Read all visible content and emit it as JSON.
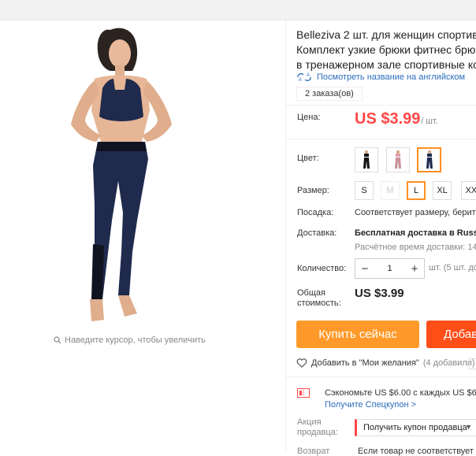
{
  "product": {
    "title_lines": [
      "Belleziva 2 шт. для женщин спортивный",
      "Комплект узкие брюки фитнес брюки",
      "в тренажерном зале спортивные ко"
    ],
    "translate_link": "Посмотреть название на английском",
    "orders": "2 заказа(ов)",
    "zoom_hint": "Наведите курсор, чтобы увеличить"
  },
  "price": {
    "label": "Цена:",
    "value": "US $3.99",
    "unit": "/ шт."
  },
  "color": {
    "label": "Цвет:",
    "swatches": [
      {
        "name": "black",
        "selected": false
      },
      {
        "name": "pink",
        "selected": false
      },
      {
        "name": "navy",
        "selected": true
      }
    ]
  },
  "size": {
    "label": "Размер:",
    "options": [
      {
        "label": "S",
        "state": "normal"
      },
      {
        "label": "M",
        "state": "disabled"
      },
      {
        "label": "L",
        "state": "selected"
      },
      {
        "label": "XL",
        "state": "normal"
      },
      {
        "label": "XXL",
        "state": "normal"
      }
    ]
  },
  "fit": {
    "label": "Посадка:",
    "value": "Соответствует размеру, берите"
  },
  "shipping": {
    "label": "Доставка:",
    "value": "Бесплатная доставка в Russia",
    "estimate": "Расчётное время доставки: 14"
  },
  "quantity": {
    "label": "Количество:",
    "value": "1",
    "minus": "−",
    "plus": "+",
    "note": "шт. (5 шт. до"
  },
  "total": {
    "label": "Общая стоимость:",
    "value": "US $3.99"
  },
  "actions": {
    "buy_now": "Купить сейчас",
    "add_to_cart": "Добав"
  },
  "wishlist": {
    "label": "Добавить в \"Мои желания\"",
    "count": "(4 добавили)"
  },
  "coupon": {
    "save_text": "Сэкономьте US $6.00 с каждых US $65.",
    "link": "Получите Спецкупон >",
    "seller_label": "Акция продавца:",
    "get_coupon": "Получить купон продавца",
    "bottom_label": "Возврат",
    "bottom_value": "Если товар не соответствует"
  },
  "colors": {
    "accent_orange": "#ff9a2a",
    "price_red": "#ff4747",
    "link_blue": "#2a6ebb",
    "cart_red": "#ff4e18"
  }
}
